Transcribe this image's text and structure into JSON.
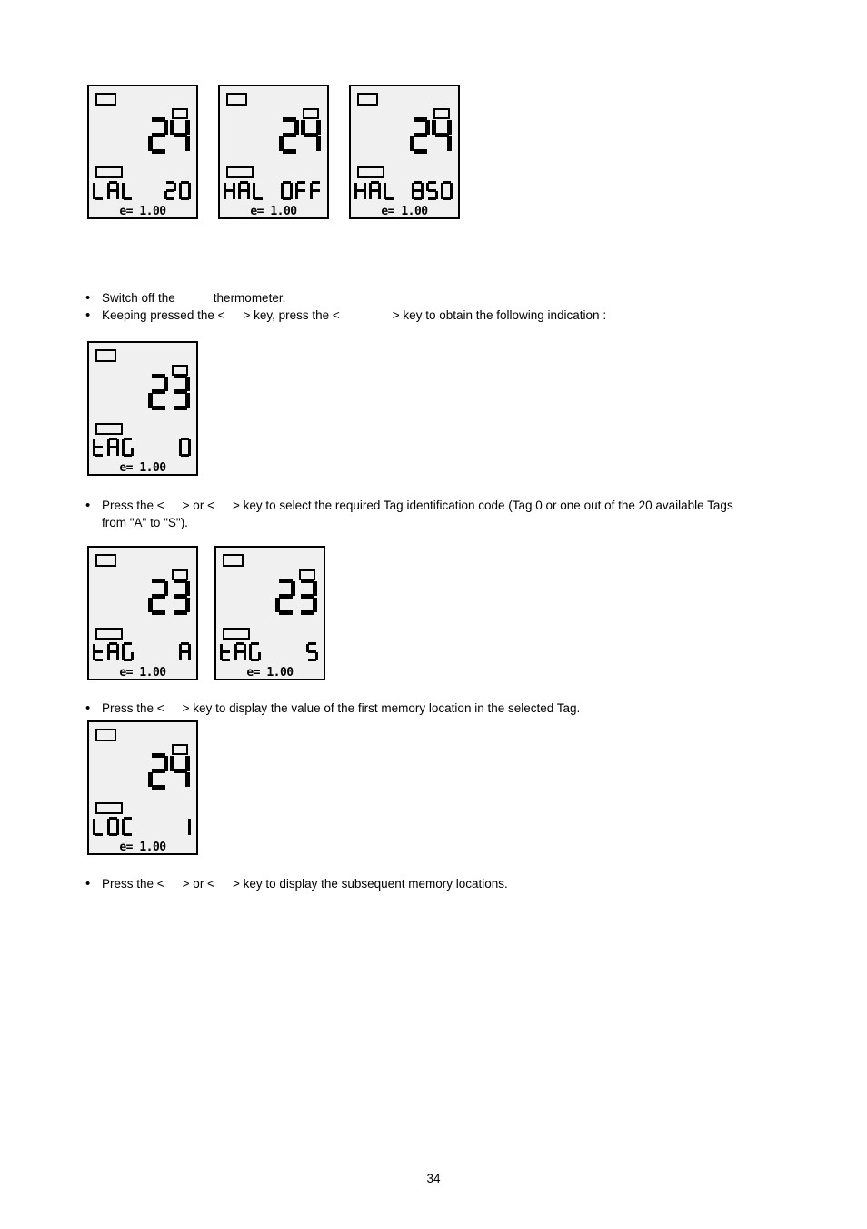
{
  "document": {
    "page_number": "34"
  },
  "displays": {
    "emissivity_label": "e= 1.00",
    "row1": [
      {
        "name": "lal-20",
        "big_value": "24",
        "text_left": "LAL",
        "text_right": "20",
        "emissivity": "e= 1.00"
      },
      {
        "name": "hal-off",
        "big_value": "24",
        "text_left": "HAL",
        "text_right": "OFF",
        "emissivity": "e= 1.00"
      },
      {
        "name": "hal-850",
        "big_value": "24",
        "text_left": "HAL",
        "text_right": "850",
        "emissivity": "e= 1.00"
      }
    ],
    "row2": [
      {
        "name": "tag-0",
        "big_value": "23",
        "text_left": "TAG",
        "text_right": "0",
        "emissivity": "e= 1.00"
      }
    ],
    "row3": [
      {
        "name": "tag-a",
        "big_value": "23",
        "text_left": "TAG",
        "text_right": "A",
        "emissivity": "e= 1.00"
      },
      {
        "name": "tag-s",
        "big_value": "23",
        "text_left": "TAG",
        "text_right": "S",
        "emissivity": "e= 1.00"
      }
    ],
    "row4": [
      {
        "name": "loc-1",
        "big_value": "24",
        "text_left": "LOC",
        "text_right": "1",
        "emissivity": "e= 1.00"
      }
    ]
  },
  "instructions": {
    "block1": [
      {
        "bullet": "•",
        "part1": "Switch off the",
        "part2": "thermometer.",
        "part3": ""
      },
      {
        "bullet": "•",
        "part1": "Keeping pressed the <",
        "part2": "> key, press the <",
        "part3": "> key to obtain the following indication :"
      }
    ],
    "block2": [
      {
        "bullet": "•",
        "part1": "Press  the <",
        "part2": "> or <",
        "part3": "> key to select the required Tag identification code (Tag 0 or one out of the 20 available Tags"
      },
      {
        "bullet": "",
        "part1": "from \"A\" to \"S\").",
        "part2": "",
        "part3": ""
      }
    ],
    "block3": [
      {
        "bullet": "•",
        "part1": "Press the <",
        "part2": "> key to display the value of the first memory location in the selected Tag.",
        "part3": ""
      }
    ],
    "block4": [
      {
        "bullet": "•",
        "part1": "Press  the <",
        "part2": "> or <",
        "part3": "> key to display the subsequent memory locations."
      }
    ]
  }
}
